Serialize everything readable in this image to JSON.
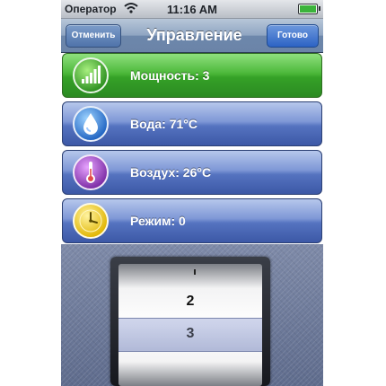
{
  "status_bar": {
    "carrier": "Оператор",
    "time": "11:16 AM"
  },
  "nav": {
    "cancel_label": "Отменить",
    "title": "Управление",
    "done_label": "Готово"
  },
  "rows": [
    {
      "label": "Мощность: 3",
      "icon": "signal-bars-icon",
      "active": true
    },
    {
      "label": "Вода: 71°C",
      "icon": "water-drop-icon",
      "active": false
    },
    {
      "label": "Воздух: 26°C",
      "icon": "thermometer-icon",
      "active": false
    },
    {
      "label": "Режим: 0",
      "icon": "clock-icon",
      "active": false
    }
  ],
  "picker": {
    "values": [
      "2",
      "3"
    ],
    "selected": "3"
  },
  "colors": {
    "active_row": "#3ca82e",
    "row_blue": "#5573c0",
    "done_button": "#2d63c4"
  }
}
